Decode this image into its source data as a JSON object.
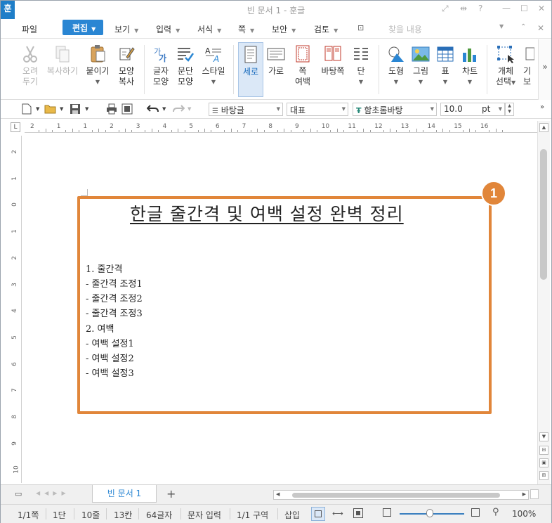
{
  "window": {
    "title": "빈 문서 1 - 훈글",
    "logo": "훈",
    "controls": [
      "?",
      "—",
      "☐",
      "✕"
    ]
  },
  "menu": {
    "file": "파일",
    "edit": "편집",
    "items": [
      "보기",
      "입력",
      "서식",
      "쪽",
      "보안",
      "검토"
    ],
    "search_placeholder": "찾을 내용",
    "accent_color": "#2a86d3"
  },
  "ribbon": {
    "cut": [
      "오려",
      "두기"
    ],
    "copy": "복사하기",
    "paste": "붙이기",
    "format_copy": [
      "모양",
      "복사"
    ],
    "char_shape": [
      "글자",
      "모양"
    ],
    "para_shape": [
      "문단",
      "모양"
    ],
    "style": "스타일",
    "vertical": "세로",
    "horizontal": "가로",
    "page_margin": [
      "쪽",
      "여백"
    ],
    "background_page": "바탕쪽",
    "column": "단",
    "shape": "도형",
    "picture": "그림",
    "table": "표",
    "chart": "차트",
    "object_select": [
      "개체",
      "선택"
    ],
    "more_partial": [
      "기",
      "보"
    ]
  },
  "toolbar": {
    "style_value": "바탕글",
    "lang_value": "대표",
    "font_value": "함초롬바탕",
    "size_value": "10.0",
    "size_unit": "pt"
  },
  "ruler": {
    "h_labels": [
      "2",
      "1",
      "1",
      "2",
      "3",
      "4",
      "5",
      "6",
      "7",
      "8",
      "9",
      "10",
      "11",
      "12",
      "13",
      "14",
      "15",
      "16"
    ],
    "v_labels": [
      "2",
      "1",
      "0",
      "1",
      "2",
      "3",
      "4",
      "5",
      "6",
      "7",
      "8",
      "9",
      "10"
    ]
  },
  "document": {
    "title": "한글 줄간격 및 여백 설정 완벽 정리",
    "lines": [
      "1. 줄간격",
      "- 줄간격 조정1",
      "- 줄간격 조정2",
      "- 줄간격 조정3",
      "2. 여백",
      "- 여백 설정1",
      "- 여백 설정2",
      "- 여백 설정3"
    ],
    "callout_number": "1",
    "callout_color": "#e1863a"
  },
  "tabs": {
    "active": "빈 문서 1",
    "add": "+"
  },
  "status": {
    "page": "1/1쪽",
    "column": "1단",
    "line": "10줄",
    "col": "13칸",
    "chars": "64글자",
    "mode": "문자 입력",
    "section": "1/1 구역",
    "insert": "삽입",
    "zoom": "100%"
  }
}
